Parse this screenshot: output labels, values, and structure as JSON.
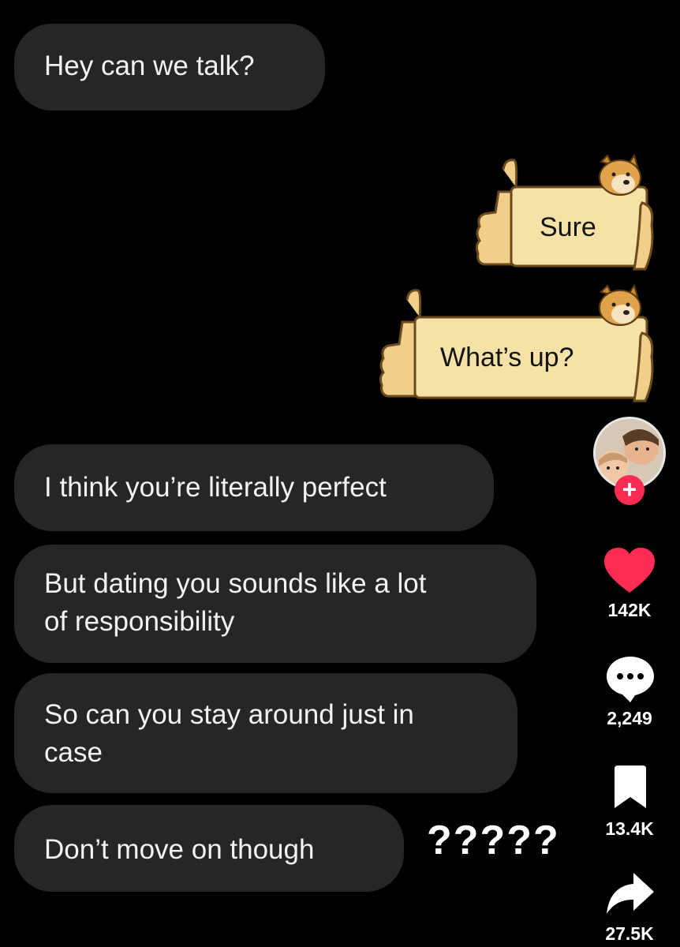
{
  "messages": [
    {
      "text": "Hey can we talk?"
    },
    {
      "text": "I think you’re literally perfect"
    },
    {
      "text_line1": "But dating you sounds like a lot",
      "text_line2": "of responsibility"
    },
    {
      "text_line1": "So can you stay around just in",
      "text_line2": "case"
    },
    {
      "text": "Don’t move on though"
    }
  ],
  "replies": [
    {
      "text": "Sure"
    },
    {
      "text": "What’s up?"
    }
  ],
  "overlay_text": "?????",
  "sidebar": {
    "avatar_icon": "profile-photo",
    "follow_label": "+",
    "likes_count": "142K",
    "comments_count": "2,249",
    "saves_count": "13.4K",
    "shares_count": "27.5K"
  },
  "colors": {
    "background": "#000000",
    "bubble": "#262626",
    "doge_sign": "#f5e2a6",
    "like_red": "#fe2c55"
  }
}
